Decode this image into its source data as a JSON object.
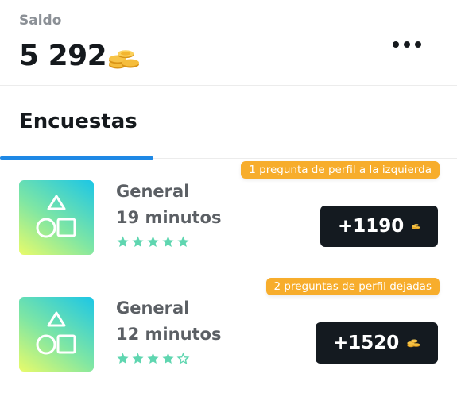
{
  "balance": {
    "label": "Saldo",
    "value": "5 292",
    "currency_icon": "coins-icon"
  },
  "menu": {
    "icon": "more-horizontal-icon"
  },
  "tabs": [
    {
      "label": "Encuestas",
      "active": true
    }
  ],
  "colors": {
    "accent": "#1e88e5",
    "badge": "#f7ad2c",
    "reward_bg": "#141a20",
    "star": "#5fd6b0",
    "coin": "#f2b233"
  },
  "surveys": [
    {
      "profile_note": "1 pregunta de perfil a la izquierda",
      "category": "General",
      "duration": "19 minutos",
      "rating": 5,
      "rating_max": 5,
      "reward": "+1190",
      "thumbnail_icon": "shapes-icon"
    },
    {
      "profile_note": "2 preguntas de perfil dejadas",
      "category": "General",
      "duration": "12 minutos",
      "rating": 4,
      "rating_max": 5,
      "reward": "+1520",
      "thumbnail_icon": "shapes-icon"
    }
  ]
}
